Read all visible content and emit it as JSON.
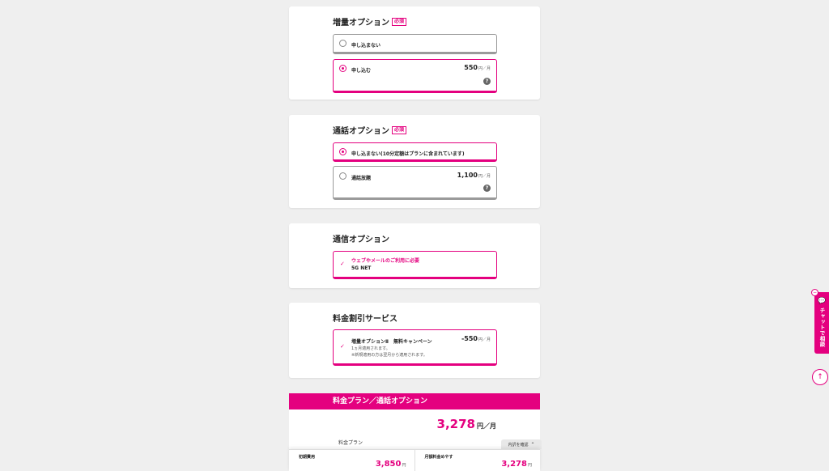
{
  "colors": {
    "accent": "#e4007f",
    "background": "#efefef"
  },
  "required_badge": "必須",
  "data_option": {
    "title": "増量オプション",
    "options": [
      {
        "label": "申し込まない",
        "selected": false
      },
      {
        "label": "申し込む",
        "price": "550",
        "unit": "円／月",
        "selected": true,
        "help_icon": "question-icon"
      }
    ]
  },
  "call_option": {
    "title": "通話オプション",
    "options": [
      {
        "label": "申し込まない(10分定額はプランに含まれています)",
        "selected": true
      },
      {
        "label": "通話放題",
        "price": "1,100",
        "unit": "円／月",
        "selected": false,
        "help_icon": "question-icon"
      }
    ]
  },
  "network_option": {
    "title": "通信オプション",
    "note": "ウェブやメールのご利用に必要",
    "label": "5G NET"
  },
  "discount_service": {
    "title": "料金割引サービス",
    "label": "増量オプションⅡ　無料キャンペーン",
    "price": "-550",
    "unit": "円／月",
    "notes": [
      "1ヵ月適用されます。",
      "※新規適用の方は翌月から適用されます。"
    ]
  },
  "summary": {
    "header": "料金プラン／通話オプション",
    "total": "3,278",
    "total_unit": "円／月",
    "row_label": "料金プラン"
  },
  "breakdown_tab": "内訳を確認",
  "bottom_bar": {
    "initial_label": "初期費用",
    "initial_value": "3,850",
    "initial_unit": "円",
    "monthly_label": "月額料金めやす",
    "monthly_value": "3,278",
    "monthly_unit": "円"
  },
  "chat": {
    "label": "チャットで相談"
  }
}
